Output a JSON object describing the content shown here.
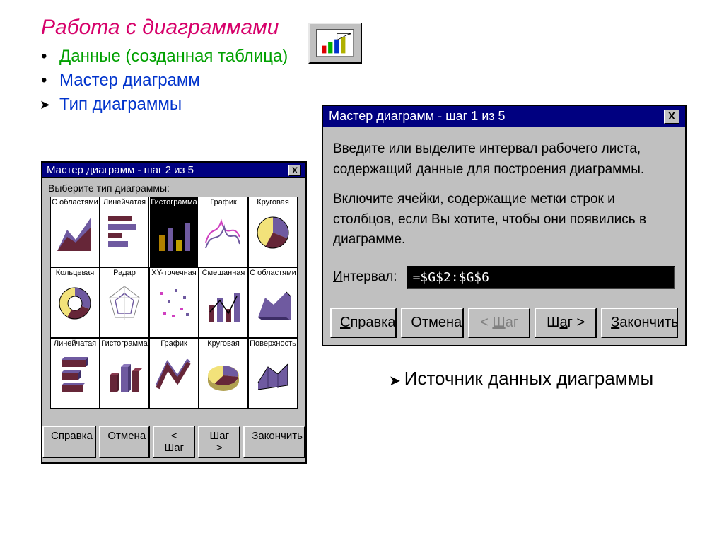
{
  "title": "Работа с диаграммами",
  "bullets": {
    "data": "Данные (созданная таблица)",
    "wizard": "Мастер диаграмм",
    "type": "Тип диаграммы"
  },
  "toolbar_icon": "chart-wizard-icon",
  "dialog2": {
    "title": "Мастер диаграмм - шаг 2 из 5",
    "prompt": "Выберите тип диаграммы:",
    "types": [
      {
        "label": "С областями",
        "kind": "area"
      },
      {
        "label": "Линейчатая",
        "kind": "hbar"
      },
      {
        "label": "Гистограмма",
        "kind": "column",
        "selected": true
      },
      {
        "label": "График",
        "kind": "line"
      },
      {
        "label": "Круговая",
        "kind": "pie"
      },
      {
        "label": "Кольцевая",
        "kind": "donut"
      },
      {
        "label": "Радар",
        "kind": "radar"
      },
      {
        "label": "XY-точечная",
        "kind": "scatter"
      },
      {
        "label": "Смешанная",
        "kind": "combo"
      },
      {
        "label": "С областями",
        "kind": "area3d"
      },
      {
        "label": "Линейчатая",
        "kind": "hbar3d"
      },
      {
        "label": "Гистограмма",
        "kind": "column3d"
      },
      {
        "label": "График",
        "kind": "line3d"
      },
      {
        "label": "Круговая",
        "kind": "pie3d"
      },
      {
        "label": "Поверхность",
        "kind": "surface"
      }
    ],
    "buttons": {
      "help": "Справка",
      "cancel": "Отмена",
      "back": "< Шаг",
      "next": "Шаг >",
      "finish": "Закончить"
    }
  },
  "dialog1": {
    "title": "Мастер диаграмм - шаг 1 из 5",
    "para1": "Введите или выделите интервал рабочего листа, содержащий данные для построения диаграммы.",
    "para2": "Включите ячейки, содержащие метки строк и столбцов, если Вы хотите, чтобы они появились в диаграмме.",
    "interval_label": "Интервал:",
    "interval_value": "=$G$2:$G$6",
    "buttons": {
      "help": "Справка",
      "cancel": "Отмена",
      "back": "< Шаг",
      "next": "Шаг >",
      "finish": "Закончить"
    }
  },
  "caption": "Источник данных диаграммы"
}
